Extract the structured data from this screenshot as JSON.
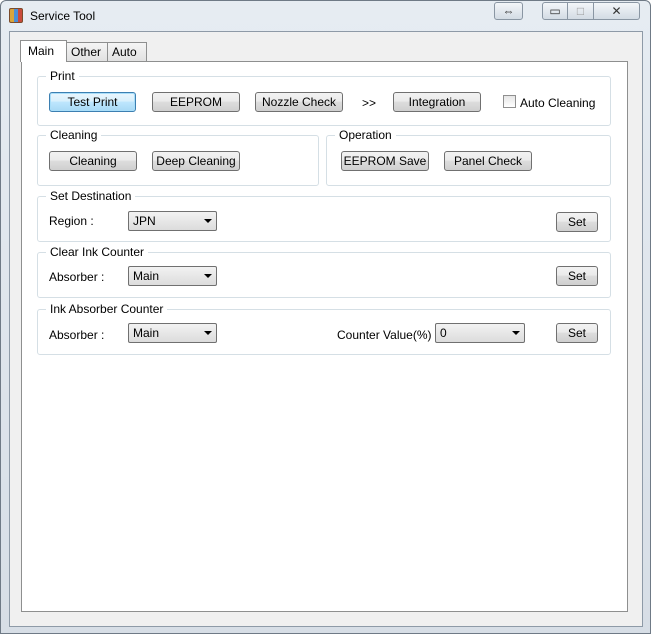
{
  "window": {
    "title": "Service Tool",
    "swap_glyph": "⇔",
    "minimize_glyph": "▭",
    "maximize_glyph": "□",
    "close_glyph": "✕"
  },
  "tabs": [
    {
      "label": "Main",
      "selected": true
    },
    {
      "label": "Other",
      "selected": false
    },
    {
      "label": "Auto",
      "selected": false
    }
  ],
  "print": {
    "legend": "Print",
    "test_print": "Test Print",
    "eeprom": "EEPROM",
    "nozzle_check": "Nozzle Check",
    "arrow": ">>",
    "integration": "Integration",
    "auto_cleaning": "Auto Cleaning",
    "auto_cleaning_checked": false
  },
  "cleaning": {
    "legend": "Cleaning",
    "cleaning": "Cleaning",
    "deep_cleaning": "Deep Cleaning"
  },
  "operation": {
    "legend": "Operation",
    "eeprom_save": "EEPROM Save",
    "panel_check": "Panel Check"
  },
  "set_destination": {
    "legend": "Set Destination",
    "region_label": "Region :",
    "region_value": "JPN",
    "set": "Set"
  },
  "clear_ink_counter": {
    "legend": "Clear Ink Counter",
    "absorber_label": "Absorber :",
    "absorber_value": "Main",
    "set": "Set"
  },
  "ink_absorber_counter": {
    "legend": "Ink Absorber Counter",
    "absorber_label": "Absorber :",
    "absorber_value": "Main",
    "counter_label": "Counter Value(%) :",
    "counter_value": "0",
    "set": "Set"
  }
}
